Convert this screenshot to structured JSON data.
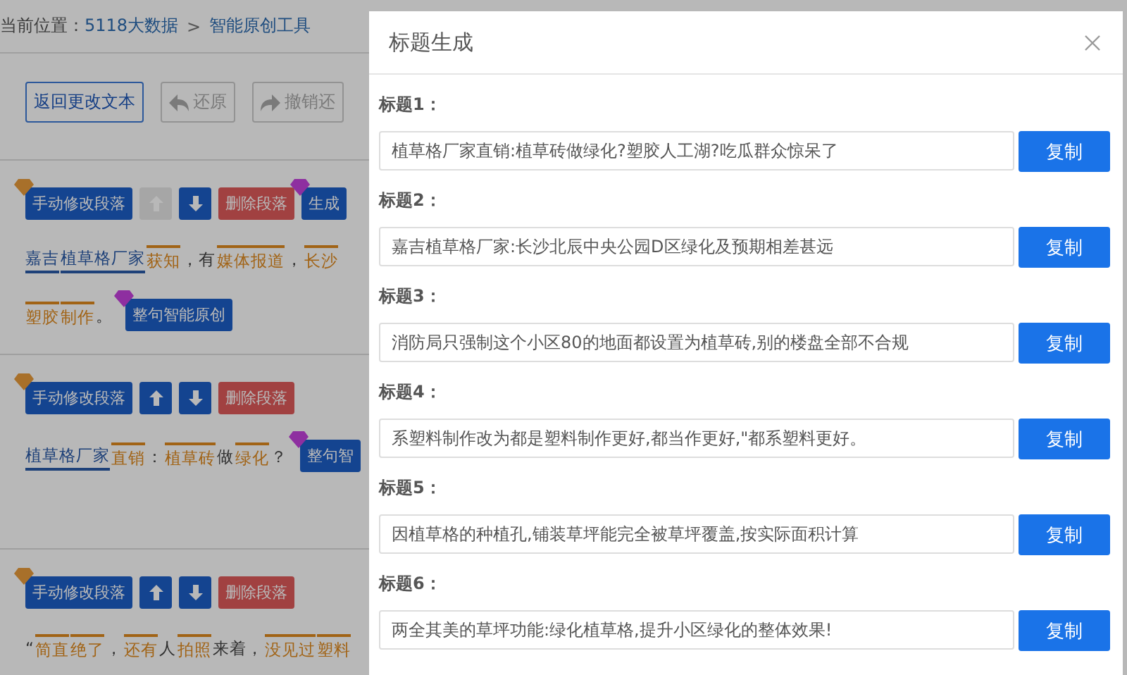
{
  "breadcrumb": {
    "label": "当前位置：",
    "links": [
      "5118大数据",
      "智能原创工具"
    ],
    "separator": ">"
  },
  "toolbar": [
    {
      "kind": "outline",
      "label": "返回更改文本",
      "disabled": false
    },
    {
      "kind": "undo",
      "label": "还原",
      "disabled": true
    },
    {
      "kind": "redo",
      "label": "撤销还",
      "disabled": true
    }
  ],
  "paragraphs": [
    {
      "actions": [
        {
          "kind": "edit",
          "label": "手动修改段落",
          "color": "#a8702a"
        },
        {
          "kind": "up",
          "disabled": true
        },
        {
          "kind": "down",
          "disabled": false
        },
        {
          "kind": "delete",
          "label": "删除段落"
        },
        {
          "kind": "edit",
          "label": "生成",
          "color": "#8e2fa0"
        }
      ],
      "lines": [
        [
          {
            "kind": "entity",
            "text": "嘉吉"
          },
          {
            "kind": "entity",
            "text": "植草格厂家"
          },
          {
            "kind": "synonym",
            "text": "获知"
          },
          {
            "kind": "plain",
            "text": "，有"
          },
          {
            "kind": "synonym",
            "text": "媒体报道"
          },
          {
            "kind": "plain",
            "text": "，"
          },
          {
            "kind": "synonym",
            "text": "长沙"
          }
        ],
        [
          {
            "kind": "synonym",
            "text": "塑胶"
          },
          {
            "kind": "synonym",
            "text": "制作"
          },
          {
            "kind": "plain",
            "text": "。"
          },
          {
            "kind": "button",
            "text": "整句智能原创",
            "color": "#8e2fa0"
          }
        ]
      ]
    },
    {
      "actions": [
        {
          "kind": "edit",
          "label": "手动修改段落",
          "color": "#a8702a"
        },
        {
          "kind": "up",
          "disabled": false
        },
        {
          "kind": "down",
          "disabled": false
        },
        {
          "kind": "delete",
          "label": "删除段落"
        }
      ],
      "lines": [
        [
          {
            "kind": "entity",
            "text": "植草格厂家"
          },
          {
            "kind": "synonym",
            "text": "直销"
          },
          {
            "kind": "plain",
            "text": "："
          },
          {
            "kind": "synonym",
            "text": "植草砖"
          },
          {
            "kind": "plain",
            "text": "做"
          },
          {
            "kind": "synonym",
            "text": "绿化"
          },
          {
            "kind": "plain",
            "text": "？"
          },
          {
            "kind": "button",
            "text": "整句智",
            "color": "#8e2fa0"
          }
        ]
      ]
    },
    {
      "actions": [
        {
          "kind": "edit",
          "label": "手动修改段落",
          "color": "#a8702a"
        },
        {
          "kind": "up",
          "disabled": false
        },
        {
          "kind": "down",
          "disabled": false
        },
        {
          "kind": "delete",
          "label": "删除段落"
        }
      ],
      "lines": [
        [
          {
            "kind": "plain",
            "text": "“"
          },
          {
            "kind": "synonym",
            "text": "简直"
          },
          {
            "kind": "synonym",
            "text": "绝了"
          },
          {
            "kind": "plain",
            "text": "，"
          },
          {
            "kind": "synonym",
            "text": "还有"
          },
          {
            "kind": "plain",
            "text": "人"
          },
          {
            "kind": "synonym",
            "text": "拍照"
          },
          {
            "kind": "plain",
            "text": "来着，"
          },
          {
            "kind": "synonym",
            "text": "没见过"
          },
          {
            "kind": "synonym",
            "text": "塑料"
          }
        ]
      ]
    }
  ],
  "modal": {
    "title": "标题生成",
    "titles": [
      {
        "label": "标题1：",
        "value": "植草格厂家直销:植草砖做绿化?塑胶人工湖?吃瓜群众惊呆了",
        "button": "复制"
      },
      {
        "label": "标题2：",
        "value": "嘉吉植草格厂家:长沙北辰中央公园D区绿化及预期相差甚远",
        "button": "复制"
      },
      {
        "label": "标题3：",
        "value": "消防局只强制这个小区80的地面都设置为植草砖,别的楼盘全部不合规",
        "button": "复制"
      },
      {
        "label": "标题4：",
        "value": "系塑料制作改为都是塑料制作更好,都当作更好,\"都系塑料更好。",
        "button": "复制"
      },
      {
        "label": "标题5：",
        "value": "因植草格的种植孔,铺装草坪能完全被草坪覆盖,按实际面积计算",
        "button": "复制"
      },
      {
        "label": "标题6：",
        "value": "两全其美的草坪功能:绿化植草格,提升小区绿化的整体效果!",
        "button": "复制"
      }
    ]
  }
}
